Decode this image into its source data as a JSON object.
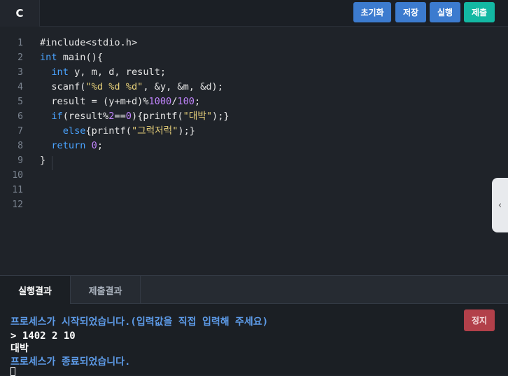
{
  "editor": {
    "language_tab": "C",
    "buttons": {
      "reset": "초기화",
      "save": "저장",
      "run": "실행",
      "submit": "제출"
    },
    "line_numbers": [
      "1",
      "2",
      "3",
      "4",
      "5",
      "6",
      "7",
      "8",
      "9",
      "10",
      "11",
      "12"
    ],
    "code": {
      "l1": "#include<stdio.h>",
      "l2_kw": "int",
      "l2_rest": " main(){",
      "l3_kw": "int",
      "l3_rest": " y, m, d, result;",
      "l4_a": "  scanf(",
      "l4_str": "\"%d %d %d\"",
      "l4_b": ", &y, &m, &d);",
      "l5_a": "  result = (y+m+d)%",
      "l5_n1": "1000",
      "l5_b": "/",
      "l5_n2": "100",
      "l5_c": ";",
      "l6_kw": "if",
      "l6_a": "(result%",
      "l6_n1": "2",
      "l6_b": "==",
      "l6_n2": "0",
      "l6_c": "){printf(",
      "l6_str": "\"대박\"",
      "l6_d": ");}",
      "l7_kw": "else",
      "l7_a": "{printf(",
      "l7_str": "\"그럭저럭\"",
      "l7_b": ");}",
      "l8_kw": "return",
      "l8_n": "0",
      "l8_b": ";",
      "l9": "}"
    },
    "side_toggle_icon": "chevron-left-icon"
  },
  "results": {
    "tabs": {
      "run_result": "실행결과",
      "submit_result": "제출결과"
    },
    "stop_label": "정지",
    "console": {
      "line1": "프로세스가 시작되었습니다.(입력값을 직접 입력해 주세요)",
      "line2": "> 1402 2 10",
      "line3": "대박",
      "line4": "프로세스가 종료되었습니다."
    }
  },
  "colors": {
    "background": "#1f2329",
    "button_blue": "#3c7bcf",
    "button_teal": "#13b8a3",
    "stop_red": "#b2404a",
    "keyword": "#4aa3ff",
    "string": "#e8d17a",
    "number": "#c084fc",
    "console_info": "#5d9be8"
  }
}
